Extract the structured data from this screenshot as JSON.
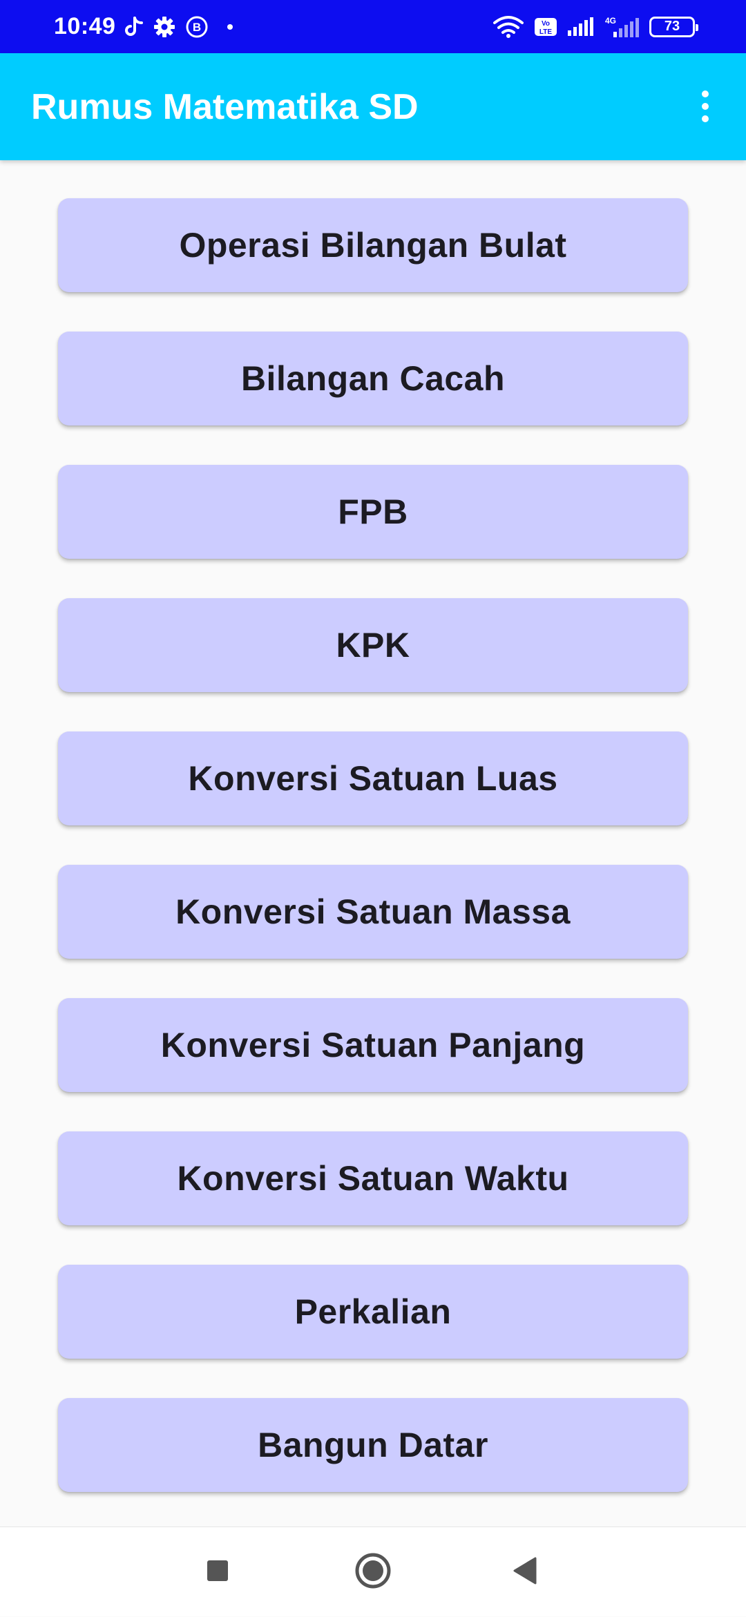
{
  "status_bar": {
    "time": "10:49",
    "battery": "73",
    "network": "4G",
    "volte": "Vo LTE"
  },
  "app_bar": {
    "title": "Rumus Matematika SD"
  },
  "menu": {
    "items": [
      {
        "label": "Operasi Bilangan Bulat"
      },
      {
        "label": "Bilangan Cacah"
      },
      {
        "label": "FPB"
      },
      {
        "label": "KPK"
      },
      {
        "label": "Konversi Satuan Luas"
      },
      {
        "label": "Konversi Satuan Massa"
      },
      {
        "label": "Konversi Satuan Panjang"
      },
      {
        "label": "Konversi Satuan Waktu"
      },
      {
        "label": "Perkalian"
      },
      {
        "label": "Bangun Datar"
      }
    ]
  },
  "colors": {
    "status_bar": "#0d0df0",
    "app_bar": "#00ccff",
    "button": "#ccccff",
    "background": "#fafafa"
  },
  "icons": {
    "status_left": [
      "tiktok-icon",
      "settings-icon",
      "b-badge-icon",
      "dot-icon"
    ],
    "status_right": [
      "wifi-icon",
      "volte-icon",
      "signal-icon",
      "4g-signal-icon",
      "battery-icon"
    ],
    "nav": [
      "recents-square-icon",
      "home-circle-icon",
      "back-triangle-icon"
    ]
  }
}
